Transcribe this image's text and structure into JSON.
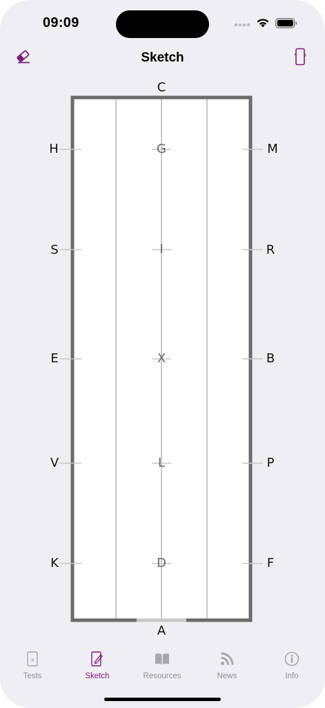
{
  "status": {
    "time": "09:09"
  },
  "nav": {
    "title": "Sketch",
    "left_icon": "eraser-icon",
    "right_icon": "phone-rotate-icon",
    "accent": "#7b1d78"
  },
  "arena": {
    "letters": {
      "top": "C",
      "bottom": "A",
      "left": [
        "H",
        "S",
        "E",
        "V",
        "K"
      ],
      "center": [
        "G",
        "I",
        "X",
        "L",
        "D"
      ],
      "right": [
        "M",
        "R",
        "B",
        "P",
        "F"
      ]
    },
    "border_color": "#6b6b6b"
  },
  "tabs": [
    {
      "label": "Tests",
      "icon": "test-sheet-icon",
      "active": false
    },
    {
      "label": "Sketch",
      "icon": "sketch-pencil-icon",
      "active": true
    },
    {
      "label": "Resources",
      "icon": "book-icon",
      "active": false
    },
    {
      "label": "News",
      "icon": "rss-icon",
      "active": false
    },
    {
      "label": "Info",
      "icon": "info-icon",
      "active": false
    }
  ]
}
